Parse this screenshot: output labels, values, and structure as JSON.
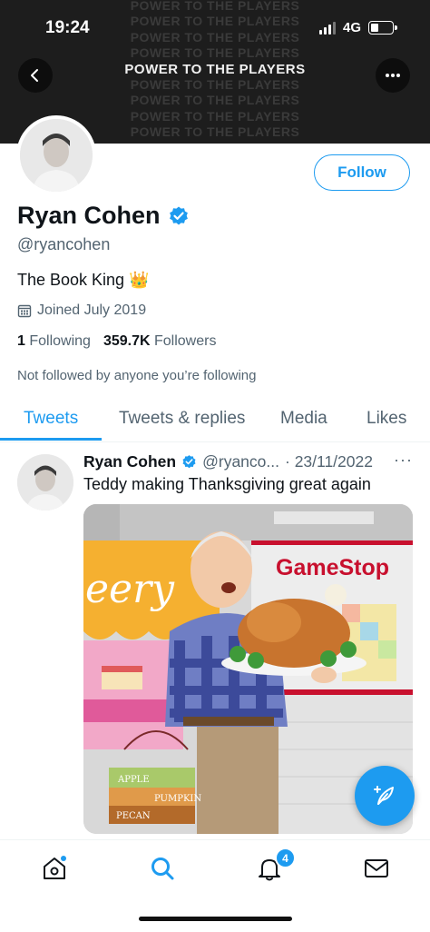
{
  "status_bar": {
    "time": "19:24",
    "network": "4G"
  },
  "banner": {
    "rows": [
      "POWER TO THE PLAYERS",
      "POWER TO THE PLAYERS",
      "POWER TO THE PLAYERS",
      "POWER TO THE PLAYERS",
      "POWER TO THE PLAYERS",
      "POWER TO THE PLAYERS",
      "POWER TO THE PLAYERS",
      "POWER TO THE PLAYERS",
      "POWER TO THE PLAYERS"
    ],
    "highlight_text": "POWER TO THE PLAYERS"
  },
  "profile": {
    "name": "Ryan Cohen",
    "handle": "@ryancohen",
    "bio": "The Book King 👑",
    "joined": "Joined July 2019",
    "following_count": "1",
    "following_label": "Following",
    "followers_count": "359.7K",
    "followers_label": "Followers",
    "not_followed_note": "Not followed by anyone you’re following",
    "follow_label": "Follow"
  },
  "tabs": [
    {
      "label": "Tweets",
      "active": true
    },
    {
      "label": "Tweets & replies",
      "active": false
    },
    {
      "label": "Media",
      "active": false
    },
    {
      "label": "Likes",
      "active": false
    }
  ],
  "tweet": {
    "author_name": "Ryan Cohen",
    "author_handle": "@ryanco...",
    "date": "· 23/11/2022",
    "more": "···",
    "text": "Teddy making Thanksgiving great again",
    "image": {
      "store_name": "GameStop",
      "bakery_sign": "eery",
      "box_labels": [
        "APPLE",
        "PUMPKIN",
        "PECAN"
      ]
    }
  },
  "bottom_nav": {
    "notifications_badge": "4"
  },
  "colors": {
    "accent": "#1d9bf0",
    "text": "#0f1419",
    "muted": "#536471"
  }
}
